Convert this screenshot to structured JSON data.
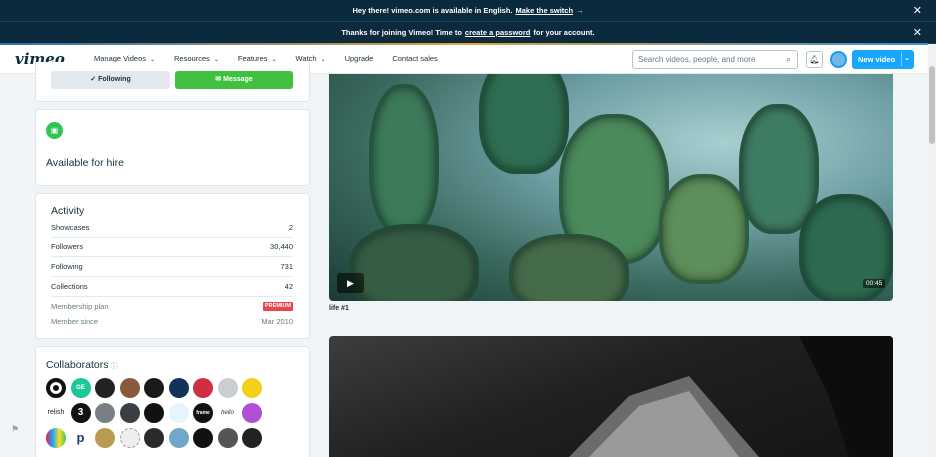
{
  "banners": {
    "lang_text": "Hey there! vimeo.com is available in English.",
    "lang_link": "Make the switch",
    "time_text_a": "Thanks for joining Vimeo! Time to",
    "time_link": "create a password",
    "time_text_b": "for your account."
  },
  "nav": {
    "logo": "vimeo",
    "items": [
      "Manage Videos",
      "Resources",
      "Features",
      "Watch",
      "Upgrade",
      "Contact sales"
    ],
    "search_placeholder": "Search videos, people, and more",
    "new_video": "New video"
  },
  "profile": {
    "following_label": "Following",
    "message_label": "Message",
    "hire_label": "Available for hire",
    "activity_title": "Activity",
    "activity": [
      {
        "label": "Showcases",
        "value": "2"
      },
      {
        "label": "Followers",
        "value": "30,440"
      },
      {
        "label": "Following",
        "value": "731"
      },
      {
        "label": "Collections",
        "value": "42"
      }
    ],
    "membership_label": "Membership plan",
    "membership_badge": "PREMIUM",
    "member_since_label": "Member since",
    "member_since_value": "Mar 2010",
    "collaborators_title": "Collaborators",
    "collaborator_texts": [
      "",
      "GE",
      "",
      "",
      "",
      "",
      "",
      "",
      "",
      "",
      "relish",
      "3",
      "",
      "",
      "",
      "",
      "frame",
      "hello",
      "",
      "",
      "",
      "p",
      "",
      "",
      "",
      "",
      "",
      "",
      "",
      ""
    ]
  },
  "videos": [
    {
      "title": "life #1",
      "duration": "00:45"
    }
  ],
  "colors": {
    "accent": "#17a7ff",
    "message_green": "#3fc03f",
    "premium_red": "#e5484d",
    "banner_bg": "#0b2a3d"
  }
}
